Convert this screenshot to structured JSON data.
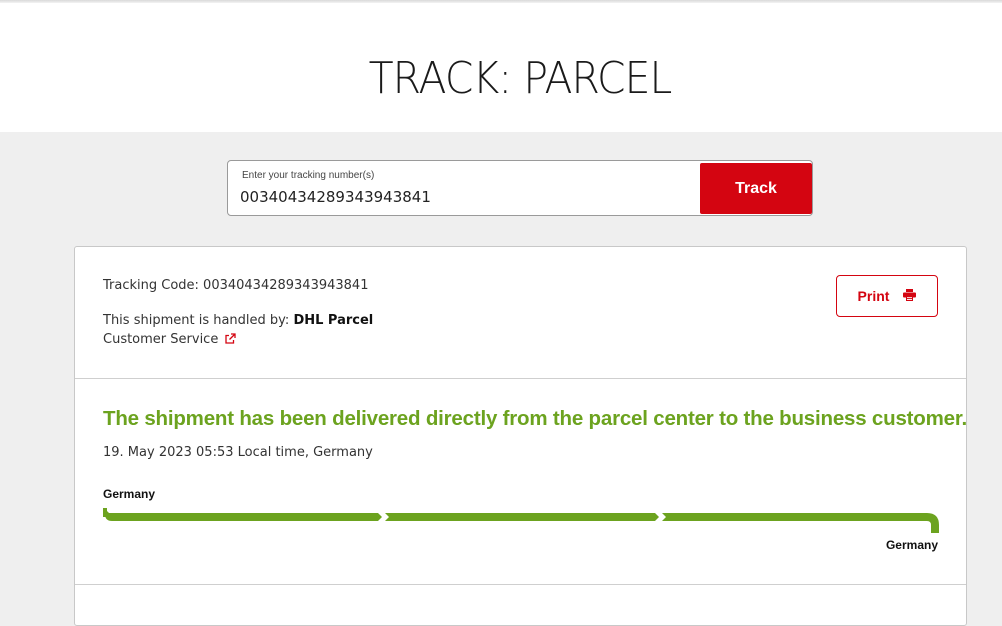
{
  "header": {
    "title": "TRACK: PARCEL"
  },
  "search": {
    "label": "Enter your tracking number(s)",
    "value": "00340434289343943841",
    "button_label": "Track"
  },
  "shipment": {
    "tracking_code_text": "Tracking Code: 00340434289343943841",
    "handled_by_prefix": "This shipment is handled by: ",
    "handled_by_carrier": "DHL Parcel",
    "customer_service_label": "Customer Service",
    "print_label": "Print",
    "status_headline": "The shipment has been delivered directly from the parcel center to the business customer.",
    "status_time": "19. May 2023 05:53 Local time, Germany",
    "origin": "Germany",
    "destination": "Germany",
    "progress_segments_complete": 3,
    "progress_segments_total": 3
  },
  "colors": {
    "brand_red": "#d40511",
    "status_green": "#6ca31f"
  },
  "icons": {
    "external_link": "external-link-icon",
    "print": "printer-icon"
  }
}
